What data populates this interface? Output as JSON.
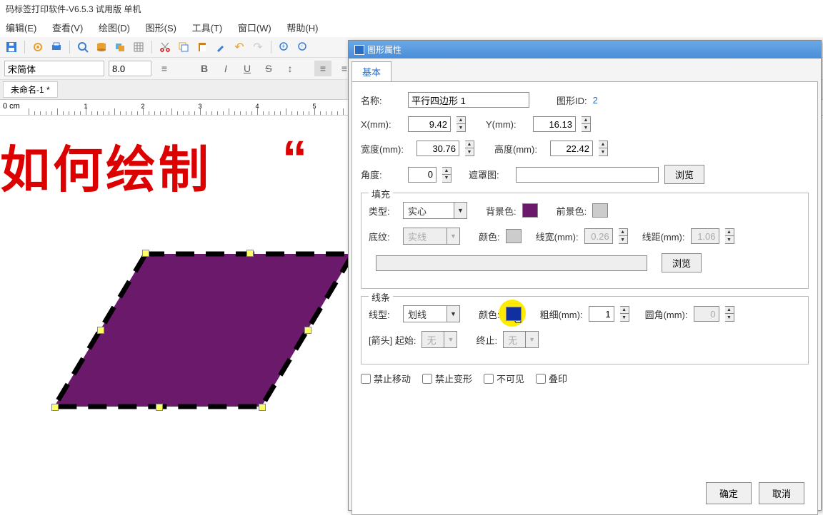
{
  "app_title": "码标签打印软件-V6.5.3 试用版 单机",
  "menus": [
    "编辑(E)",
    "查看(V)",
    "绘图(D)",
    "图形(S)",
    "工具(T)",
    "窗口(W)",
    "帮助(H)"
  ],
  "format": {
    "font": "宋简体",
    "size": "8.0"
  },
  "doc_tab": "未命名-1 *",
  "ruler_origin": "0 cm",
  "red_text": "如何绘制",
  "red_quote": "“",
  "dialog": {
    "title": "图形属性",
    "tab": "基本",
    "name_lbl": "名称:",
    "name_val": "平行四边形 1",
    "id_lbl": "图形ID:",
    "id_val": "2",
    "x_lbl": "X(mm):",
    "x_val": "9.42",
    "y_lbl": "Y(mm):",
    "y_val": "16.13",
    "w_lbl": "宽度(mm):",
    "w_val": "30.76",
    "h_lbl": "高度(mm):",
    "h_val": "22.42",
    "angle_lbl": "角度:",
    "angle_val": "0",
    "mask_lbl": "遮罩图:",
    "browse": "浏览",
    "fill": {
      "title": "填充",
      "type_lbl": "类型:",
      "type_val": "实心",
      "bg_lbl": "背景色:",
      "fg_lbl": "前景色:",
      "pattern_lbl": "底纹:",
      "pattern_val": "实线",
      "color_lbl": "颜色:",
      "lw_lbl": "线宽(mm):",
      "lw_val": "0.26",
      "sp_lbl": "线距(mm):",
      "sp_val": "1.06",
      "browse2": "浏览"
    },
    "line": {
      "title": "线条",
      "type_lbl": "线型:",
      "type_val": "划线",
      "color_lbl": "颜色:",
      "weight_lbl": "粗细(mm):",
      "weight_val": "1",
      "round_lbl": "圆角(mm):",
      "round_val": "0",
      "arrow_lbl": "[箭头] 起始:",
      "arrow_start": "无",
      "arrow_end_lbl": "终止:",
      "arrow_end": "无"
    },
    "checks": [
      "禁止移动",
      "禁止变形",
      "不可见",
      "叠印"
    ],
    "ok": "确定",
    "cancel": "取消"
  }
}
